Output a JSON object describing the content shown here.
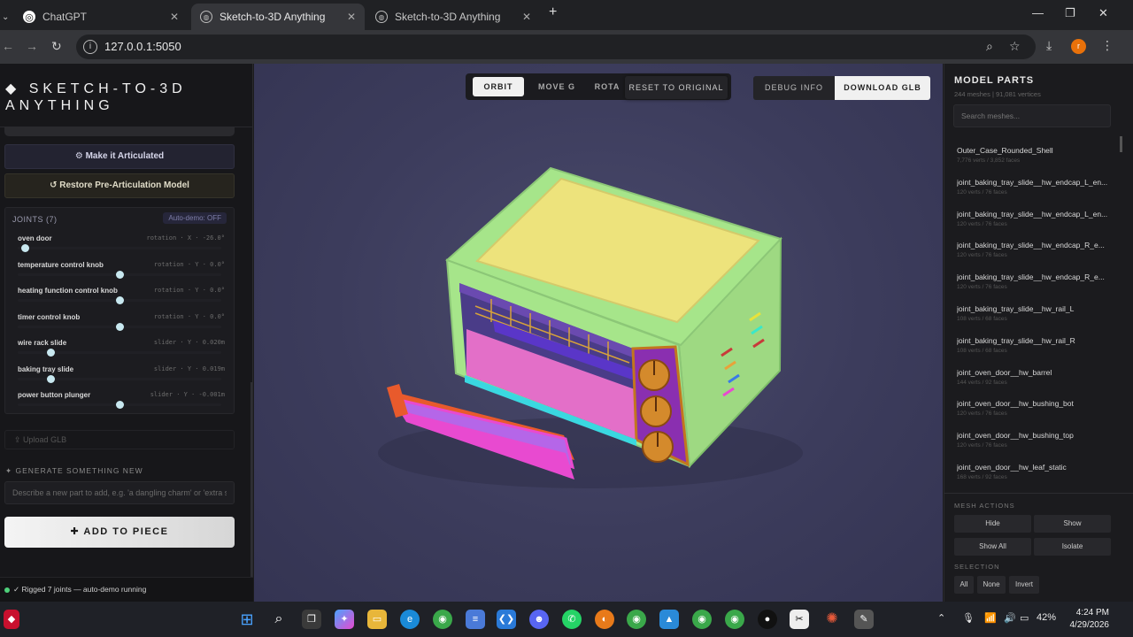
{
  "browser": {
    "tabs": [
      {
        "title": "ChatGPT",
        "active": false
      },
      {
        "title": "Sketch-to-3D Anything",
        "active": true
      },
      {
        "title": "Sketch-to-3D Anything",
        "active": false
      }
    ],
    "new_tab": "+",
    "url": "127.0.0.1:5050"
  },
  "left": {
    "brand_line1": "◆ SKETCH-TO-3D",
    "brand_line2": "ANYTHING",
    "articulate_label": "⚙ Make it Articulated",
    "restore_label": "↺ Restore Pre-Articulation Model",
    "joints_title": "JOINTS (7)",
    "autodemo": "Auto-demo: OFF",
    "joints": [
      {
        "name": "oven door",
        "info": "rotation · X · -26.0°",
        "value": 0.02
      },
      {
        "name": "temperature control knob",
        "info": "rotation · Y · 0.0°",
        "value": 0.5
      },
      {
        "name": "heating function control knob",
        "info": "rotation · Y · 0.0°",
        "value": 0.5
      },
      {
        "name": "timer control knob",
        "info": "rotation · Y · 0.0°",
        "value": 0.5
      },
      {
        "name": "wire rack slide",
        "info": "slider · Y · 0.020m",
        "value": 0.15
      },
      {
        "name": "baking tray slide",
        "info": "slider · Y · 0.019m",
        "value": 0.15
      },
      {
        "name": "power button plunger",
        "info": "slider · Y · -0.001m",
        "value": 0.5
      }
    ],
    "upload_label": "⇪ Upload GLB",
    "generate_title": "✦ GENERATE SOMETHING NEW",
    "generate_placeholder": "Describe a new part to add, e.g. 'a dangling charm' or 'extra s",
    "add_button": "✚ ADD TO PIECE",
    "status": "✓ Rigged 7 joints — auto-demo running"
  },
  "viewport": {
    "modes": [
      "ORBIT",
      "MOVE G",
      "ROTA"
    ],
    "active_mode": "ORBIT",
    "reset": "RESET TO ORIGINAL",
    "debug": "DEBUG INFO",
    "download": "DOWNLOAD GLB"
  },
  "right": {
    "title": "MODEL PARTS",
    "subtitle": "244 meshes | 91,081 vertices",
    "search_placeholder": "Search meshes...",
    "meshes": [
      {
        "name": "Outer_Case_Rounded_Shell",
        "stats": "7,776 verts / 3,852 faces"
      },
      {
        "name": "joint_baking_tray_slide__hw_endcap_L_en...",
        "stats": "120 verts / 76 faces"
      },
      {
        "name": "joint_baking_tray_slide__hw_endcap_L_en...",
        "stats": "120 verts / 76 faces"
      },
      {
        "name": "joint_baking_tray_slide__hw_endcap_R_e...",
        "stats": "120 verts / 76 faces"
      },
      {
        "name": "joint_baking_tray_slide__hw_endcap_R_e...",
        "stats": "120 verts / 76 faces"
      },
      {
        "name": "joint_baking_tray_slide__hw_rail_L",
        "stats": "108 verts / 68 faces"
      },
      {
        "name": "joint_baking_tray_slide__hw_rail_R",
        "stats": "108 verts / 68 faces"
      },
      {
        "name": "joint_oven_door__hw_barrel",
        "stats": "144 verts / 92 faces"
      },
      {
        "name": "joint_oven_door__hw_bushing_bot",
        "stats": "120 verts / 76 faces"
      },
      {
        "name": "joint_oven_door__hw_bushing_top",
        "stats": "120 verts / 76 faces"
      },
      {
        "name": "joint_oven_door__hw_leaf_static",
        "stats": "168 verts / 92 faces"
      }
    ],
    "mesh_actions_title": "MESH ACTIONS",
    "actions": [
      "Hide",
      "Show",
      "Show All",
      "Isolate"
    ],
    "selection_title": "SELECTION",
    "selection": [
      "All",
      "None",
      "Invert"
    ]
  },
  "taskbar": {
    "battery": "42%",
    "time": "4:24 PM",
    "date": "4/29/2026"
  },
  "colors": {
    "case": "#a6e58a",
    "top_panel": "#ede37c",
    "door": "#b566e8",
    "door_trim": "#e85a2c",
    "control_panel": "#c2761e",
    "accent_pink": "#e84ad0"
  }
}
